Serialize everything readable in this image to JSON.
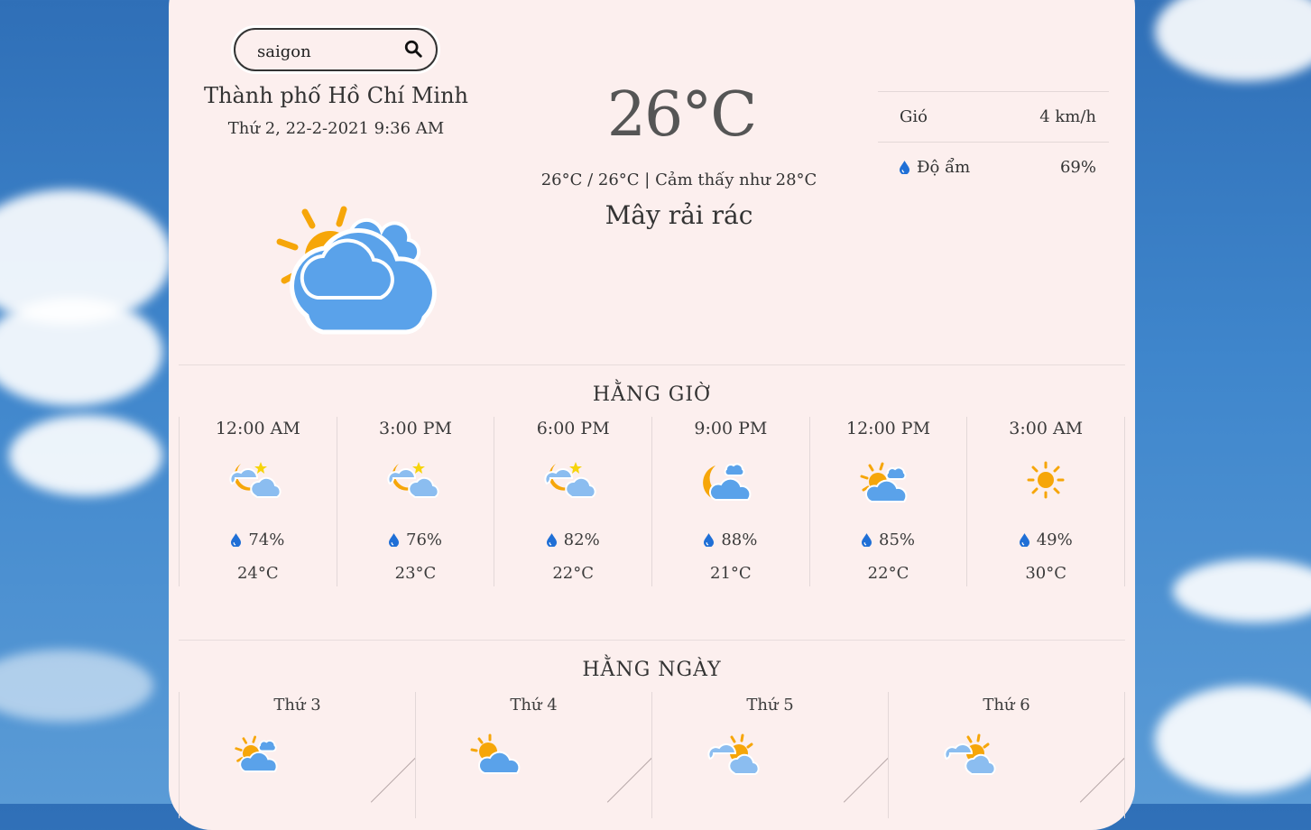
{
  "search": {
    "value": "saigon",
    "placeholder": ""
  },
  "location": {
    "city": "Thành phố Hồ Chí Minh",
    "datetime": "Thứ 2, 22-2-2021 9:36 AM"
  },
  "current": {
    "temp": "26°C",
    "range": "26°C / 26°C | Cảm thấy như 28°C",
    "description": "Mây rải rác",
    "icon": "sun-behind-clouds-icon"
  },
  "stats": [
    {
      "label": "Gió",
      "value": "4 km/h",
      "icon": ""
    },
    {
      "label": "Độ ẩm",
      "value": "69%",
      "icon": "water-drop-icon"
    }
  ],
  "hourly": {
    "title": "HẰNG GIỜ",
    "items": [
      {
        "time": "12:00 AM",
        "humidity": "74%",
        "temp": "24°C",
        "icon": "night-cloudy-icon"
      },
      {
        "time": "3:00 PM",
        "humidity": "76%",
        "temp": "23°C",
        "icon": "night-cloudy-icon"
      },
      {
        "time": "6:00 PM",
        "humidity": "82%",
        "temp": "22°C",
        "icon": "night-cloudy-icon"
      },
      {
        "time": "9:00 PM",
        "humidity": "88%",
        "temp": "21°C",
        "icon": "moon-cloud-icon"
      },
      {
        "time": "12:00 PM",
        "humidity": "85%",
        "temp": "22°C",
        "icon": "sun-cloud-icon"
      },
      {
        "time": "3:00 AM",
        "humidity": "49%",
        "temp": "30°C",
        "icon": "sun-icon"
      }
    ]
  },
  "daily": {
    "title": "HẰNG NGÀY",
    "items": [
      {
        "day": "Thứ 3",
        "icon": "sun-cloud-icon"
      },
      {
        "day": "Thứ 4",
        "icon": "sun-cloud-icon"
      },
      {
        "day": "Thứ 5",
        "icon": "sun-clouds-icon"
      },
      {
        "day": "Thứ 6",
        "icon": "sun-clouds-icon"
      }
    ]
  },
  "colors": {
    "card": "#fcefee",
    "cloud": "#5aa2ea",
    "sun": "#f6a609",
    "drop": "#1f6fd6"
  }
}
